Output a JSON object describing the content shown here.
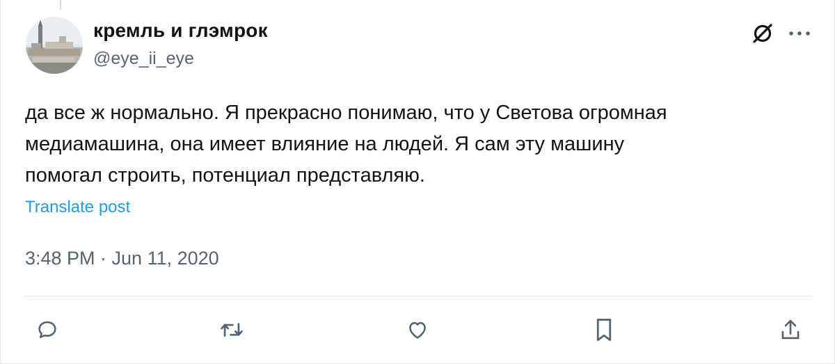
{
  "author": {
    "display_name": "кремль и глэмрок",
    "handle": "@eye_ii_eye",
    "avatar_icon": "avatar-photo"
  },
  "tweet": {
    "lines": [
      "да все ж нормально. Я прекрасно понимаю, что у Светова огромная",
      "медиамашина, она имеет влияние на людей. Я сам эту машину",
      "помогал строить, потенциал представляю."
    ],
    "translate_label": "Translate post",
    "timestamp": "3:48 PM · Jun 11, 2020"
  },
  "header_icons": [
    "grok-icon",
    "more-icon"
  ],
  "actions": [
    "reply-icon",
    "retweet-icon",
    "like-icon",
    "bookmark-icon",
    "share-icon"
  ],
  "colors": {
    "text": "#0f1419",
    "secondary": "#536471",
    "link": "#1d9bf0",
    "divider": "#e1e6ea"
  }
}
